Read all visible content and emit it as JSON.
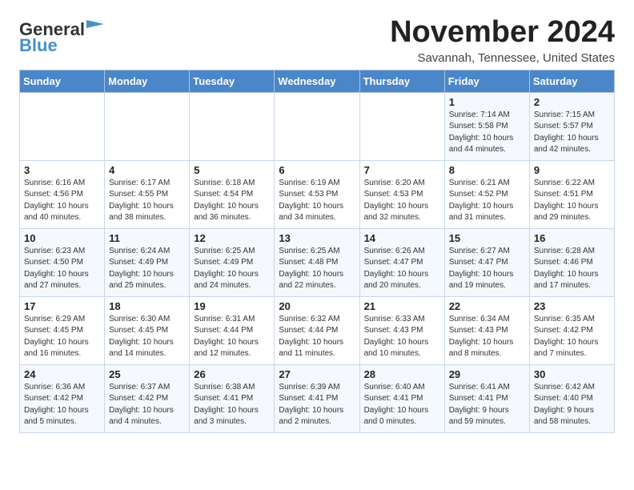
{
  "app": {
    "logo_general": "General",
    "logo_blue": "Blue",
    "month": "November 2024",
    "location": "Savannah, Tennessee, United States"
  },
  "calendar": {
    "headers": [
      "Sunday",
      "Monday",
      "Tuesday",
      "Wednesday",
      "Thursday",
      "Friday",
      "Saturday"
    ],
    "weeks": [
      [
        {
          "day": "",
          "info": ""
        },
        {
          "day": "",
          "info": ""
        },
        {
          "day": "",
          "info": ""
        },
        {
          "day": "",
          "info": ""
        },
        {
          "day": "",
          "info": ""
        },
        {
          "day": "1",
          "info": "Sunrise: 7:14 AM\nSunset: 5:58 PM\nDaylight: 10 hours\nand 44 minutes."
        },
        {
          "day": "2",
          "info": "Sunrise: 7:15 AM\nSunset: 5:57 PM\nDaylight: 10 hours\nand 42 minutes."
        }
      ],
      [
        {
          "day": "3",
          "info": "Sunrise: 6:16 AM\nSunset: 4:56 PM\nDaylight: 10 hours\nand 40 minutes."
        },
        {
          "day": "4",
          "info": "Sunrise: 6:17 AM\nSunset: 4:55 PM\nDaylight: 10 hours\nand 38 minutes."
        },
        {
          "day": "5",
          "info": "Sunrise: 6:18 AM\nSunset: 4:54 PM\nDaylight: 10 hours\nand 36 minutes."
        },
        {
          "day": "6",
          "info": "Sunrise: 6:19 AM\nSunset: 4:53 PM\nDaylight: 10 hours\nand 34 minutes."
        },
        {
          "day": "7",
          "info": "Sunrise: 6:20 AM\nSunset: 4:53 PM\nDaylight: 10 hours\nand 32 minutes."
        },
        {
          "day": "8",
          "info": "Sunrise: 6:21 AM\nSunset: 4:52 PM\nDaylight: 10 hours\nand 31 minutes."
        },
        {
          "day": "9",
          "info": "Sunrise: 6:22 AM\nSunset: 4:51 PM\nDaylight: 10 hours\nand 29 minutes."
        }
      ],
      [
        {
          "day": "10",
          "info": "Sunrise: 6:23 AM\nSunset: 4:50 PM\nDaylight: 10 hours\nand 27 minutes."
        },
        {
          "day": "11",
          "info": "Sunrise: 6:24 AM\nSunset: 4:49 PM\nDaylight: 10 hours\nand 25 minutes."
        },
        {
          "day": "12",
          "info": "Sunrise: 6:25 AM\nSunset: 4:49 PM\nDaylight: 10 hours\nand 24 minutes."
        },
        {
          "day": "13",
          "info": "Sunrise: 6:25 AM\nSunset: 4:48 PM\nDaylight: 10 hours\nand 22 minutes."
        },
        {
          "day": "14",
          "info": "Sunrise: 6:26 AM\nSunset: 4:47 PM\nDaylight: 10 hours\nand 20 minutes."
        },
        {
          "day": "15",
          "info": "Sunrise: 6:27 AM\nSunset: 4:47 PM\nDaylight: 10 hours\nand 19 minutes."
        },
        {
          "day": "16",
          "info": "Sunrise: 6:28 AM\nSunset: 4:46 PM\nDaylight: 10 hours\nand 17 minutes."
        }
      ],
      [
        {
          "day": "17",
          "info": "Sunrise: 6:29 AM\nSunset: 4:45 PM\nDaylight: 10 hours\nand 16 minutes."
        },
        {
          "day": "18",
          "info": "Sunrise: 6:30 AM\nSunset: 4:45 PM\nDaylight: 10 hours\nand 14 minutes."
        },
        {
          "day": "19",
          "info": "Sunrise: 6:31 AM\nSunset: 4:44 PM\nDaylight: 10 hours\nand 12 minutes."
        },
        {
          "day": "20",
          "info": "Sunrise: 6:32 AM\nSunset: 4:44 PM\nDaylight: 10 hours\nand 11 minutes."
        },
        {
          "day": "21",
          "info": "Sunrise: 6:33 AM\nSunset: 4:43 PM\nDaylight: 10 hours\nand 10 minutes."
        },
        {
          "day": "22",
          "info": "Sunrise: 6:34 AM\nSunset: 4:43 PM\nDaylight: 10 hours\nand 8 minutes."
        },
        {
          "day": "23",
          "info": "Sunrise: 6:35 AM\nSunset: 4:42 PM\nDaylight: 10 hours\nand 7 minutes."
        }
      ],
      [
        {
          "day": "24",
          "info": "Sunrise: 6:36 AM\nSunset: 4:42 PM\nDaylight: 10 hours\nand 5 minutes."
        },
        {
          "day": "25",
          "info": "Sunrise: 6:37 AM\nSunset: 4:42 PM\nDaylight: 10 hours\nand 4 minutes."
        },
        {
          "day": "26",
          "info": "Sunrise: 6:38 AM\nSunset: 4:41 PM\nDaylight: 10 hours\nand 3 minutes."
        },
        {
          "day": "27",
          "info": "Sunrise: 6:39 AM\nSunset: 4:41 PM\nDaylight: 10 hours\nand 2 minutes."
        },
        {
          "day": "28",
          "info": "Sunrise: 6:40 AM\nSunset: 4:41 PM\nDaylight: 10 hours\nand 0 minutes."
        },
        {
          "day": "29",
          "info": "Sunrise: 6:41 AM\nSunset: 4:41 PM\nDaylight: 9 hours\nand 59 minutes."
        },
        {
          "day": "30",
          "info": "Sunrise: 6:42 AM\nSunset: 4:40 PM\nDaylight: 9 hours\nand 58 minutes."
        }
      ]
    ]
  }
}
